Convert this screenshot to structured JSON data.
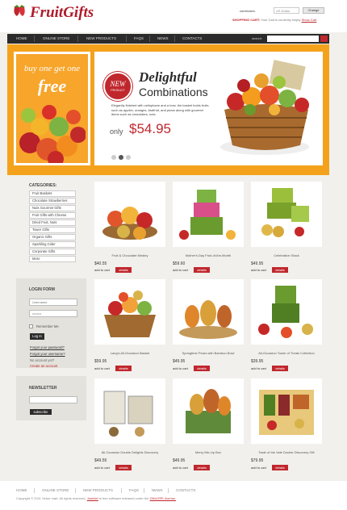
{
  "header": {
    "logo_prefix": "Fruit",
    "logo_suffix": "Gifts",
    "currencies_label": "currencies:",
    "currency_value": "US Dollar",
    "change_label": "Change",
    "cart_label": "SHOPPING CART:",
    "cart_text": " Your Cart is currently empty ",
    "cart_link": "Show Cart"
  },
  "nav": {
    "items": [
      "Home",
      "Online Store",
      "New Products",
      "FAQs",
      "News",
      "Contacts"
    ],
    "search_label": "search:",
    "colors": {
      "bar": "#2b2b2b",
      "accent": "#c0272d"
    }
  },
  "banner": {
    "promo_line1": "buy one get one",
    "promo_line2": "free",
    "badge_line1": "NEW",
    "badge_line2": "Product",
    "title_line1": "Delightful",
    "title_line2": "Combinations",
    "description": "Elegantly finished with cellophane and a bow, the basket holds fruits such as apples, oranges, kiwifruit, and pears along with gourmet items such as chocolates, nuts.",
    "only_label": "only",
    "price": "$54.95",
    "slider_dots": 3,
    "active_dot": 1,
    "background_color": "#f4a21c"
  },
  "sidebar": {
    "categories_title": "Categories:",
    "categories": [
      "Fruit Baskets",
      "Chocolate Strawberries",
      "Nuts Gourmet Gifts",
      "Fruit Gifts with Cheese",
      "Dried Fruit, Nuts",
      "Tower Gifts",
      "Organic Gifts",
      "Sparkling Cider",
      "Corporate Gifts",
      "More"
    ],
    "login_title": "Login form",
    "username_placeholder": "Username",
    "password_placeholder": "••••••••",
    "remember_label": "Remember Me",
    "login_button": "Log In",
    "forgot_password": "Forgot your password?",
    "forgot_username": "Forgot your username?",
    "no_account": "No account yet?",
    "create_account": "Create an account",
    "newsletter_title": "Newsletter",
    "subscribe_button": "subscribe"
  },
  "products": [
    {
      "name": "Fruit & Chocolate Medley",
      "price": "$40.55",
      "cart": "add to cart",
      "details": "details",
      "icon": "fruit-basket"
    },
    {
      "name": "Mother's Day Fruit-of-the-Month",
      "price": "$59.60",
      "cart": "add to cart",
      "details": "details",
      "icon": "gift-tower"
    },
    {
      "name": "Celebration Stack",
      "price": "$49.95",
      "cart": "add to cart",
      "details": "details",
      "icon": "gift-stack"
    },
    {
      "name": "Lang's All-Occasion Basket",
      "price": "$59.95",
      "cart": "add to cart",
      "details": "details",
      "icon": "basket"
    },
    {
      "name": "Springtime Pears with Bamboo Bowl",
      "price": "$49.95",
      "cart": "add to cart",
      "details": "details",
      "icon": "pears"
    },
    {
      "name": "All-Occasion Tower of Treats Collection",
      "price": "$39.95",
      "cart": "add to cart",
      "details": "details",
      "icon": "treat-tower"
    },
    {
      "name": "All-Occasion Double Delights Discovery",
      "price": "$49.55",
      "cart": "add to cart",
      "details": "details",
      "icon": "boxes"
    },
    {
      "name": "Merry Mix-Up Box",
      "price": "$49.95",
      "cart": "add to cart",
      "details": "details",
      "icon": "fruit-box"
    },
    {
      "name": "Taste of the Vale Double Discovery Gift",
      "price": "$79.95",
      "cart": "add to cart",
      "details": "details",
      "icon": "gourmet-box"
    }
  ],
  "footer": {
    "nav": [
      "Home",
      "Online Store",
      "New Products",
      "FAQs",
      "News",
      "Contacts"
    ],
    "copyright_prefix": "Copyright © 2011 Virtue mart. All rights reserved. ",
    "copyright_link1": "Joomla!",
    "copyright_middle": " is free software released under the ",
    "copyright_link2": "GNU/GPL license."
  }
}
